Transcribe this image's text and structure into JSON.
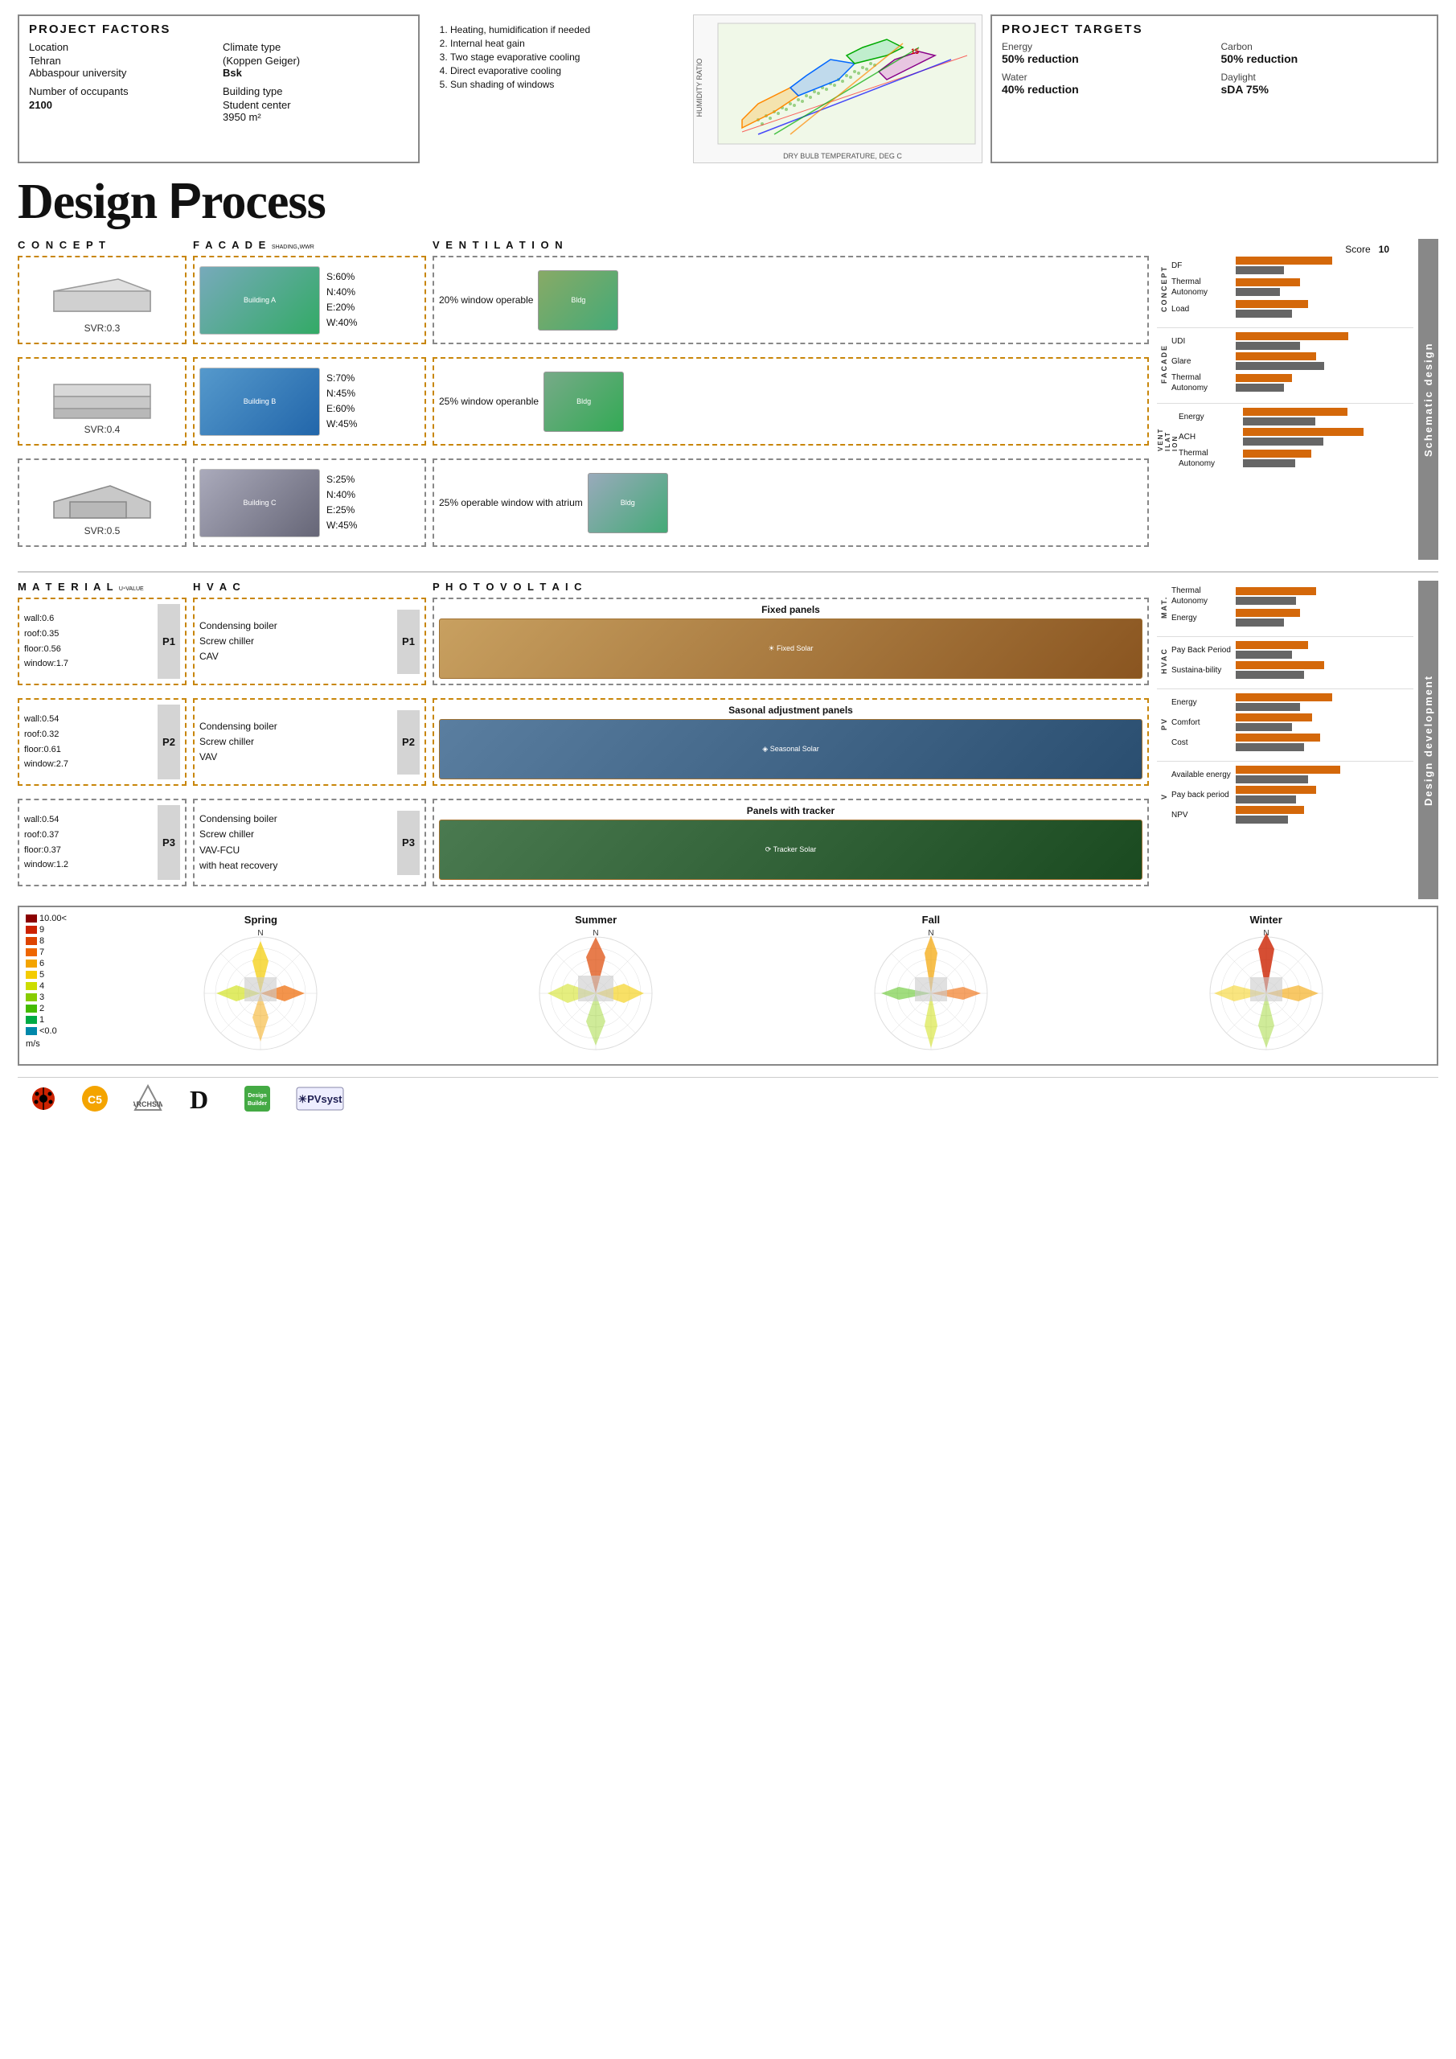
{
  "page": {
    "title": "Design Process"
  },
  "project_factors": {
    "header": "Project Factors",
    "location_label": "Location",
    "location_value": "Tehran",
    "university": "Abbaspour university",
    "climate_label": "Climate type",
    "climate_value": "(Koppen Geiger)",
    "climate_code": "Bsk",
    "building_label": "Building type",
    "building_value": "Student center",
    "building_area": "3950 m²",
    "occupants_label": "Number of occupants",
    "occupants_value": "2100"
  },
  "project_targets": {
    "header": "Project Targets",
    "energy_label": "Energy",
    "energy_value": "50% reduction",
    "carbon_label": "Carbon",
    "carbon_value": "50% reduction",
    "water_label": "Water",
    "water_value": "40% reduction",
    "daylight_label": "Daylight",
    "daylight_value": "sDA 75%"
  },
  "passive_strategies": {
    "items": [
      "1.Heating, humidification if needed",
      "2.Internal heat gain",
      "3.Two stage evaporative cooling",
      "4.Direct evaporative cooling",
      "5.Sun shading of windows"
    ]
  },
  "design_process_title": "Design Process",
  "col_labels": {
    "concept": "C O N C E P T",
    "facade": "F A C A D E  shading,wwr",
    "ventilation": "V E N T I L A T I O N"
  },
  "concept_boxes": [
    {
      "svr": "SVR:0.3",
      "border": "orange"
    },
    {
      "svr": "SVR:0.4",
      "border": "orange"
    },
    {
      "svr": "SVR:0.5",
      "border": "gray"
    }
  ],
  "facade_boxes": [
    {
      "label": "S:60%\nN:40%\nE:20%\nW:40%",
      "border": "orange"
    },
    {
      "label": "S:70%\nN:45%\nE:60%\nW:45%",
      "border": "orange"
    },
    {
      "label": "S:25%\nN:40%\nE:25%\nW:45%",
      "border": "gray"
    }
  ],
  "ventilation_boxes": [
    {
      "label": "20% window operable",
      "border": "gray"
    },
    {
      "label": "25% window operanble",
      "border": "orange"
    },
    {
      "label": "25% operable window with atrium",
      "border": "gray"
    }
  ],
  "score_header": {
    "label": "Score",
    "max": "10"
  },
  "schematic_scores": [
    {
      "section": "CONCEPT",
      "metrics": [
        {
          "name": "DF",
          "bar1": 120,
          "bar2": 60
        },
        {
          "name": "Thermal Autonomy",
          "bar1": 80,
          "bar2": 55
        },
        {
          "name": "Load",
          "bar1": 90,
          "bar2": 70
        }
      ]
    },
    {
      "section": "FACADE",
      "metrics": [
        {
          "name": "UDI",
          "bar1": 140,
          "bar2": 80
        },
        {
          "name": "Glare",
          "bar1": 100,
          "bar2": 110
        },
        {
          "name": "Thermal Autonomy",
          "bar1": 70,
          "bar2": 60
        }
      ]
    },
    {
      "section": "VENTILATION",
      "metrics": [
        {
          "name": "Energy",
          "bar1": 130,
          "bar2": 90
        },
        {
          "name": "ACH",
          "bar1": 150,
          "bar2": 100
        },
        {
          "name": "Thermal Autonomy",
          "bar1": 85,
          "bar2": 65
        }
      ]
    }
  ],
  "dev_col_labels": {
    "material": "M A T E R I A L  u-value",
    "hvac": "H V A C",
    "pv": "P H O T O V O L T A I C"
  },
  "material_boxes": [
    {
      "id": "P1",
      "text": "wall:0.6\nroof:0.35\nfloor:0.56\nwindow:1.7",
      "border": "orange"
    },
    {
      "id": "P2",
      "text": "wall:0.54\nroof:0.32\nfloor:0.61\nwindow:2.7",
      "border": "orange"
    },
    {
      "id": "P3",
      "text": "wall:0.54\nroof:0.37\nfloor:0.37\nwindow:1.2",
      "border": "gray"
    }
  ],
  "hvac_boxes": [
    {
      "id": "P1",
      "text": "Condensing boiler\nScrew chiller\nCAV",
      "border": "orange"
    },
    {
      "id": "P2",
      "text": "Condensing boiler\nScrew chiller\nVAV",
      "border": "orange"
    },
    {
      "id": "P3",
      "text": "Condensing boiler\nScrew chiller\nVAV-FCU\nwith heat recovery",
      "border": "gray"
    }
  ],
  "pv_boxes": [
    {
      "id": "P1",
      "label": "Fixed panels",
      "color": "brown",
      "border": "gray"
    },
    {
      "id": "P2",
      "label": "Sasonal adjustment panels",
      "color": "blue",
      "border": "orange"
    },
    {
      "id": "P3",
      "label": "Panels with tracker",
      "color": "green",
      "border": "gray"
    }
  ],
  "dev_scores": [
    {
      "section": "MATERIAL",
      "metrics": [
        {
          "name": "Thermal Autonomy",
          "bar1": 100,
          "bar2": 75
        },
        {
          "name": "Energy",
          "bar1": 80,
          "bar2": 60
        }
      ]
    },
    {
      "section": "HVAC",
      "metrics": [
        {
          "name": "Pay Back Period",
          "bar1": 90,
          "bar2": 70
        },
        {
          "name": "Sustaina-bility",
          "bar1": 110,
          "bar2": 85
        }
      ]
    },
    {
      "section": "PV",
      "metrics": [
        {
          "name": "Energy",
          "bar1": 120,
          "bar2": 80
        },
        {
          "name": "Comfort",
          "bar1": 95,
          "bar2": 70
        },
        {
          "name": "Cost",
          "bar1": 105,
          "bar2": 85
        }
      ]
    },
    {
      "section": "PV2",
      "metrics": [
        {
          "name": "Available energy",
          "bar1": 130,
          "bar2": 90
        },
        {
          "name": "Pay back period",
          "bar1": 100,
          "bar2": 75
        },
        {
          "name": "NPV",
          "bar1": 85,
          "bar2": 65
        }
      ]
    }
  ],
  "wind_rose": {
    "seasons": [
      "Spring",
      "Summer",
      "Fall",
      "Winter"
    ],
    "legend": [
      {
        "label": "10.00<",
        "color": "#8B0000"
      },
      {
        "label": "9",
        "color": "#cc2200"
      },
      {
        "label": "8",
        "color": "#dd4400"
      },
      {
        "label": "7",
        "color": "#ee6600"
      },
      {
        "label": "6",
        "color": "#f4a400"
      },
      {
        "label": "5",
        "color": "#f4cc00"
      },
      {
        "label": "4",
        "color": "#ccdd00"
      },
      {
        "label": "3",
        "color": "#88cc00"
      },
      {
        "label": "2",
        "color": "#44bb00"
      },
      {
        "label": "1",
        "color": "#00aa44"
      },
      {
        "label": "<0.0",
        "color": "#0088aa"
      }
    ],
    "unit": "m/s"
  },
  "logos": [
    "Ladybug Tools",
    "C5",
    "ARCHSIM",
    "D",
    "DesignBuilder",
    "PVsyst"
  ],
  "colors": {
    "orange": "#d4680a",
    "gray": "#888888",
    "dark_orange": "#c8860a",
    "accent": "#c8860a"
  }
}
